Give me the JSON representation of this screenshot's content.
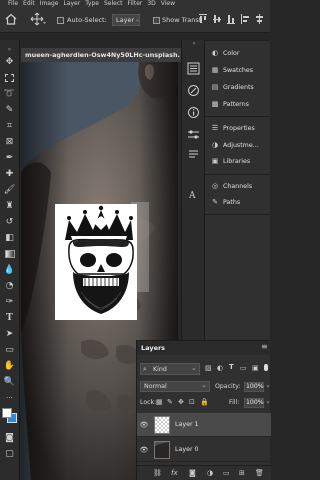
{
  "menu": [
    "File",
    "Edit",
    "Image",
    "Layer",
    "Type",
    "Select",
    "Filter",
    "3D",
    "View"
  ],
  "options": {
    "auto_select_label": "Auto-Select:",
    "auto_select_value": "Layer",
    "show_transform_label": "Show Transf"
  },
  "document": {
    "tab_title": "mueen-agherdien-Osw4Ny50LHc-unsplash."
  },
  "panels": {
    "items": [
      {
        "label": "Color",
        "icon": "color-wheel-icon"
      },
      {
        "label": "Swatches",
        "icon": "grid-icon"
      },
      {
        "label": "Gradients",
        "icon": "gradient-icon"
      },
      {
        "label": "Patterns",
        "icon": "pattern-icon"
      },
      {
        "label": "Properties",
        "icon": "sliders-icon"
      },
      {
        "label": "Adjustme...",
        "icon": "adjust-icon"
      },
      {
        "label": "Libraries",
        "icon": "library-icon"
      },
      {
        "label": "Channels",
        "icon": "channels-icon"
      },
      {
        "label": "Paths",
        "icon": "paths-icon"
      }
    ]
  },
  "layers": {
    "title": "Layers",
    "filter_label": "Kind",
    "blend_mode": "Normal",
    "opacity_label": "Opacity:",
    "opacity_value": "100%",
    "lock_label": "Lock:",
    "fill_label": "Fill:",
    "fill_value": "100%",
    "rows": [
      {
        "name": "Layer 1"
      },
      {
        "name": "Layer 0"
      }
    ],
    "footer": [
      "link-icon",
      "fx-icon",
      "mask-icon",
      "adjustment-icon",
      "group-icon",
      "new-layer-icon",
      "trash-icon"
    ]
  },
  "colors": {
    "app_bg": "#262626",
    "panel_bg": "#303030",
    "accent": "#2f89d8",
    "canvas_bg": "#4a5763"
  }
}
